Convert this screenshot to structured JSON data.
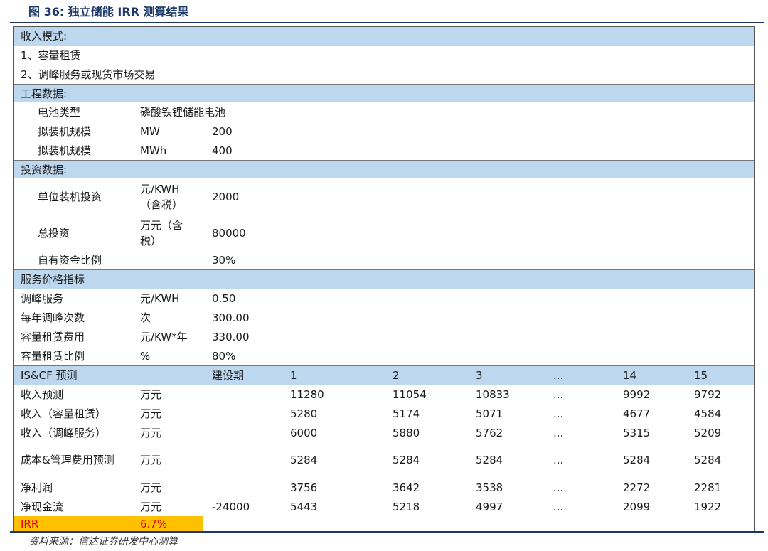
{
  "title": "图 36:  独立储能 IRR 测算结果",
  "income_mode": {
    "header": "收入模式:",
    "items": [
      "1、容量租赁",
      "2、调峰服务或现货市场交易"
    ]
  },
  "engineering": {
    "header": "工程数据:",
    "rows": [
      {
        "label": "电池类型",
        "unit": "磷酸铁锂储能电池",
        "value": ""
      },
      {
        "label": "拟装机规模",
        "unit": "MW",
        "value": "200"
      },
      {
        "label": "拟装机规模",
        "unit": "MWh",
        "value": "400"
      }
    ]
  },
  "investment": {
    "header": "投资数据:",
    "rows": [
      {
        "label": "单位装机投资",
        "unit": "元/KWH（含税）",
        "value": "2000"
      },
      {
        "label": "总投资",
        "unit": "万元（含税）",
        "value": "80000"
      },
      {
        "label": "自有资金比例",
        "unit": "",
        "value": "30%"
      }
    ]
  },
  "pricing": {
    "header": "服务价格指标",
    "rows": [
      {
        "label": "调峰服务",
        "unit": "元/KWH",
        "value": "0.50"
      },
      {
        "label": "每年调峰次数",
        "unit": "次",
        "value": "300.00"
      },
      {
        "label": "容量租赁费用",
        "unit": "元/KW*年",
        "value": "330.00"
      },
      {
        "label": "容量租赁比例",
        "unit": "%",
        "value": "80%"
      }
    ]
  },
  "forecast": {
    "header": {
      "label": "IS&CF 预测",
      "cols": [
        "建设期",
        "1",
        "2",
        "3",
        "...",
        "14",
        "15"
      ]
    },
    "rows": [
      {
        "label": "收入预测",
        "unit": "万元",
        "values": [
          "",
          "11280",
          "11054",
          "10833",
          "...",
          "9992",
          "9792"
        ]
      },
      {
        "label": "收入（容量租赁）",
        "unit": "万元",
        "values": [
          "",
          "5280",
          "5174",
          "5071",
          "...",
          "4677",
          "4584"
        ]
      },
      {
        "label": "收入（调峰服务）",
        "unit": "万元",
        "values": [
          "",
          "6000",
          "5880",
          "5762",
          "...",
          "5315",
          "5209"
        ]
      },
      {
        "label": "成本&管理费用预测",
        "unit": "万元",
        "values": [
          "",
          "5284",
          "5284",
          "5284",
          "...",
          "5284",
          "5284"
        ]
      },
      {
        "label": "净利润",
        "unit": "万元",
        "values": [
          "",
          "3756",
          "3642",
          "3538",
          "...",
          "2272",
          "2281"
        ]
      },
      {
        "label": "净现金流",
        "unit": "万元",
        "values": [
          "-24000",
          "5443",
          "5218",
          "4997",
          "...",
          "2099",
          "1922"
        ]
      }
    ]
  },
  "irr": {
    "label": "IRR",
    "value": "6.7%"
  },
  "source": "资料来源：信达证券研发中心测算",
  "colors": {
    "band": "#bdd7ee",
    "irr_highlight": "#ffc000",
    "irr_text": "#e00000",
    "title": "#1b3768"
  }
}
